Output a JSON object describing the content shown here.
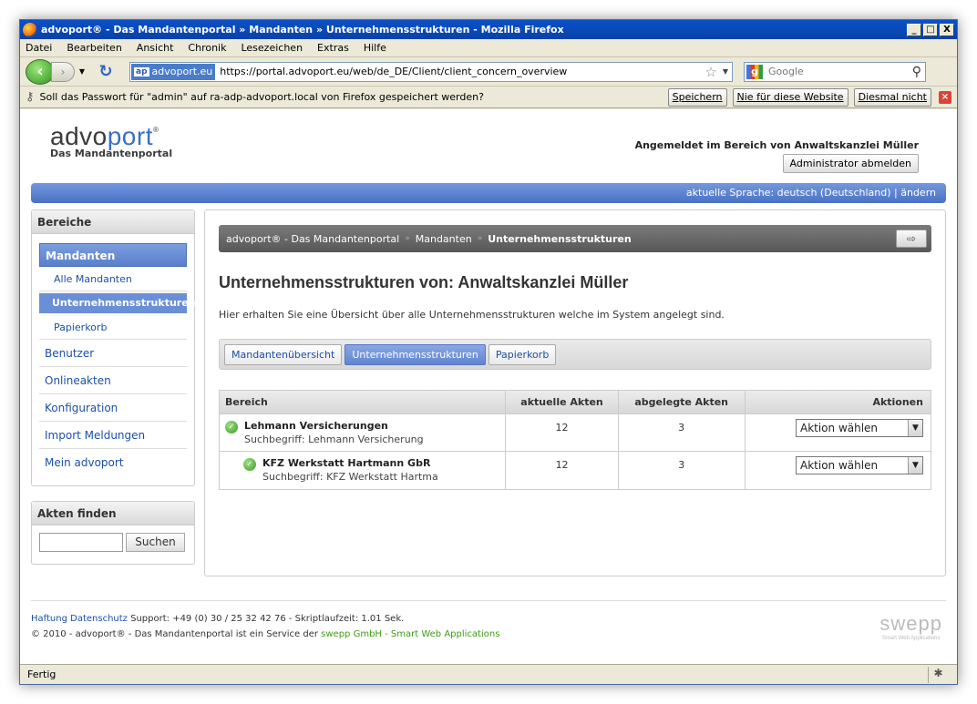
{
  "window": {
    "title": "advoport® - Das Mandantenportal » Mandanten » Unternehmensstrukturen - Mozilla Firefox",
    "minimize": "_",
    "maximize": "□",
    "close": "X"
  },
  "menu": [
    "Datei",
    "Bearbeiten",
    "Ansicht",
    "Chronik",
    "Lesezeichen",
    "Extras",
    "Hilfe"
  ],
  "nav": {
    "site_identity": "advoport.eu",
    "site_badge": "ap",
    "url": "https://portal.advoport.eu/web/de_DE/Client/client_concern_overview",
    "search_placeholder": "Google"
  },
  "notification": {
    "text": "Soll das Passwort für \"admin\" auf ra-adp-advoport.local von Firefox gespeichert werden?",
    "buttons": [
      "Speichern",
      "Nie für diese Website",
      "Diesmal nicht"
    ]
  },
  "header": {
    "brand_1": "advo",
    "brand_2": "port",
    "brand_reg": "®",
    "tagline": "Das Mandantenportal",
    "login_info": "Angemeldet im Bereich von Anwaltskanzlei Müller",
    "logout_label": "Administrator abmelden",
    "language": "aktuelle Sprache: deutsch (Deutschland) | ändern"
  },
  "sidebar": {
    "areas_title": "Bereiche",
    "active_section": "Mandanten",
    "sub_items": [
      "Alle Mandanten",
      "Unternehmensstrukturen",
      "Papierkorb"
    ],
    "items": [
      "Benutzer",
      "Onlineakten",
      "Konfiguration",
      "Import Meldungen",
      "Mein advoport"
    ],
    "find_title": "Akten finden",
    "find_button": "Suchen"
  },
  "main": {
    "breadcrumb": [
      "advoport® - Das Mandantenportal",
      "Mandanten",
      "Unternehmensstrukturen"
    ],
    "breadcrumb_sep": "»",
    "title": "Unternehmensstrukturen von: Anwaltskanzlei Müller",
    "description": "Hier erhalten Sie eine Übersicht über alle Unternehmensstrukturen welche im System angelegt sind.",
    "tabs": [
      "Mandantenübersicht",
      "Unternehmensstrukturen",
      "Papierkorb"
    ],
    "table": {
      "headers": [
        "Bereich",
        "aktuelle Akten",
        "abgelegte Akten",
        "Aktionen"
      ],
      "rows": [
        {
          "name": "Lehmann Versicherungen",
          "sub": "Suchbegriff: Lehmann Versicherung",
          "current": "12",
          "archived": "3",
          "action": "Aktion wählen"
        },
        {
          "name": "KFZ Werkstatt Hartmann GbR",
          "sub": "Suchbegriff: KFZ Werkstatt Hartma",
          "current": "12",
          "archived": "3",
          "action": "Aktion wählen"
        }
      ]
    }
  },
  "footer": {
    "links": [
      "Haftung",
      "Datenschutz"
    ],
    "support": "Support: +49 (0) 30 / 25 32 42 76 - Skriptlaufzeit: 1.01 Sek.",
    "copyright": "© 2010 - advoport® - Das Mandantenportal ist ein Service der",
    "service_link": "swepp GmbH - Smart Web Applications",
    "swepp_logo": "swepp",
    "swepp_tagline": "Smart Web Applications"
  },
  "status": "Fertig",
  "colors": {
    "accent_blue": "#5a80cc",
    "link_blue": "#1b4fa8",
    "ok_green": "#3f9b2a"
  }
}
